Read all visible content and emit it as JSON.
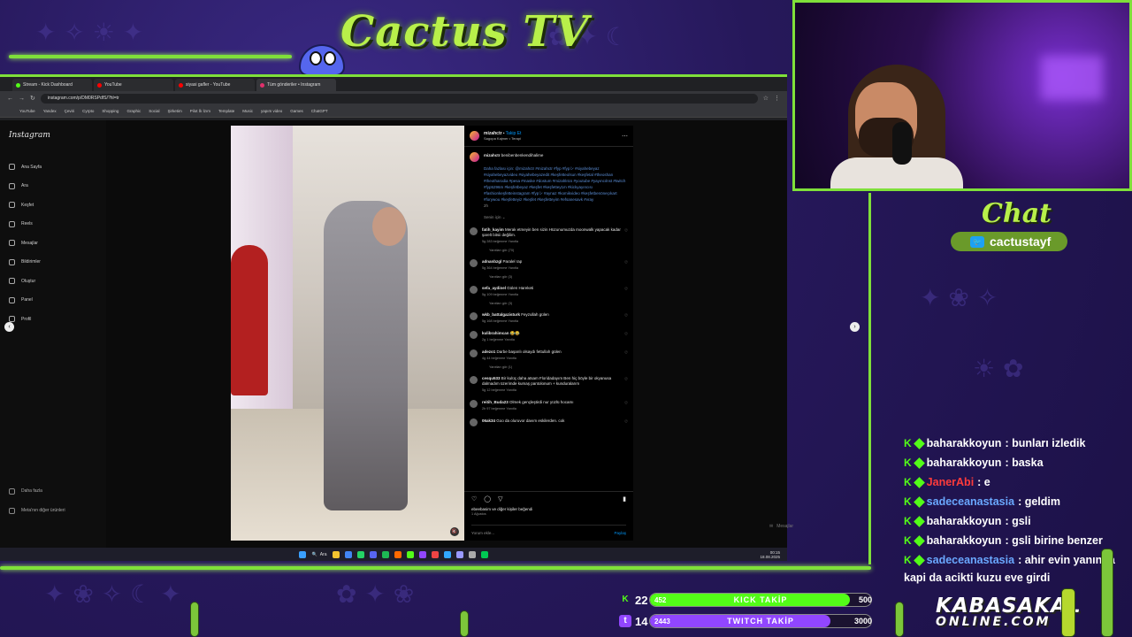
{
  "brand": {
    "title": "Cactus TV"
  },
  "browser": {
    "tabs": [
      {
        "label": "Stream - Kick Dashboard",
        "color": "#53fc18"
      },
      {
        "label": "YouTube",
        "color": "#ff0000"
      },
      {
        "label": "siyasi gafler - YouTube",
        "color": "#ff0000"
      },
      {
        "label": "Tüm gönderiler • Instagram",
        "color": "#e1306c"
      }
    ],
    "url": "instagram.com/p/DM0RSPdfS/?hl=tr",
    "bookmarks": [
      "YouTube",
      "Yandex",
      "Çeviri",
      "Cyrpto",
      "Shopping",
      "Graphic",
      "Social",
      "Şirketim",
      "Pilot İlı İzım",
      "Template",
      "Music",
      "yapım video",
      "Games",
      "ChatGPT"
    ]
  },
  "instagram": {
    "logo": "Instagram",
    "nav": [
      "Ana Sayfa",
      "Ara",
      "Keşfet",
      "Reels",
      "Mesajlar",
      "Bildirimler",
      "Oluştur",
      "Panel",
      "Profil"
    ],
    "more": [
      "Daha fazla",
      "Meta'nın diğer ürünleri"
    ],
    "post": {
      "user": "mizahctr",
      "follow": "Takip Et",
      "subtitle": "Sagopa Kajmer • Terapi",
      "caption_user": "mizahctr",
      "caption_text": "benibenbenkendihalime",
      "caption_tags": "Daha fazlası için: @mizahctr #mizahctr #fyp #fypシ #siyahebeyaz #siyahebeyazvideo #siyahebeyazedit #keşfetteolsun #keşfetal #theoshan #theotharodia #pesa #maske #dostum #mizahlıtcs #youtube #yayıncılnst #twitch #fyp5296m #keşfetbeyaz #keşfet #keşfettey1m #kickyayıncısı #fashionkeşfetteinstagram #fypシ #aynaz #komikvideo #keşfetbenöneçıkart #forywou #keşfetteyiz #keşfet #keşfetteyim #efsanesavk #vray",
      "caption_time": "2h",
      "for_you": "Senin için",
      "comments": [
        {
          "user": "fatih_kayim",
          "text": "Merak etmeyin ben sizin Hüzunumuzda moonwalk yapacak kadar şarelt bitsii değilim.",
          "meta": "5g 283 beğenme Yanıtla",
          "replies": "Yanıtları gör (70)"
        },
        {
          "user": "adnanbzgl",
          "text": "Paralel rap",
          "meta": "5g 364 beğenme Yanıtla",
          "replies": "Yanıtları gör (3)"
        },
        {
          "user": "sefa_aydinel",
          "text": "Gülen Hareketi",
          "meta": "5g 109 beğenme Yanıtla",
          "replies": "Yanıtları gör (3)"
        },
        {
          "user": "wkb_battalgazisturk",
          "text": "Feyzullah gülen",
          "meta": "5g 168 beğenme Yanıtla",
          "replies": ""
        },
        {
          "user": "kulibrahimcan",
          "text": "😂😂",
          "meta": "2g 1 beğenme Yanıtla",
          "replies": ""
        },
        {
          "user": "adezo1",
          "text": "Darbe başarılı olsaydı fettullah gülen",
          "meta": "4g 44 beğenme Yanıtla",
          "replies": "Yanıtları gör (1)"
        },
        {
          "user": "cesqu533",
          "text": "Bir kulüç daha atsam Floridadayım Ben hiç böyle bir okyanusa dalmadım üzerimde kumaş pantolonum + kunduralarım",
          "meta": "5g 12 beğenme Yanıtla",
          "replies": ""
        },
        {
          "user": "reitih_Buda23",
          "text": "Olmek gençleştirdi nur yüzlü hocamı",
          "meta": "2h 97 beğenme Yanıtla",
          "replies": ""
        },
        {
          "user": "06ak34",
          "text": "Goo da oluruvor davım eskilerden. cok",
          "meta": "",
          "replies": ""
        }
      ],
      "liked_by": "ebeebasim ve diğer kişiler beğendi",
      "date": "1 Ağustos",
      "add_comment": "Yorum ekle...",
      "share": "Paylaş"
    },
    "messages": "Mesajlar"
  },
  "taskbar": {
    "search": "Ara",
    "time": "00:15",
    "date": "18.08.2025"
  },
  "chat": {
    "title": "Chat",
    "handle": "cactustayf",
    "messages": [
      {
        "user": "baharakkoyun",
        "text": ": bunları izledik",
        "color": "#ffffff"
      },
      {
        "user": "baharakkoyun",
        "text": ": baska",
        "color": "#ffffff"
      },
      {
        "user": "JanerAbi",
        "text": ": e",
        "color": "#ff3b3b"
      },
      {
        "user": "sadeceanastasia",
        "text": ": geldim",
        "color": "#6aa8ff"
      },
      {
        "user": "baharakkoyun",
        "text": ": gsli",
        "color": "#ffffff"
      },
      {
        "user": "baharakkoyun",
        "text": ": gsli birine benzer",
        "color": "#ffffff"
      },
      {
        "user": "sadeceanastasia",
        "text": ": ahir evin yanında",
        "color": "#6aa8ff"
      }
    ],
    "last_line": "kapi da acikti kuzu eve girdi"
  },
  "goals": {
    "kick": {
      "label": "KICK TAKİP",
      "count": "22",
      "current": "452",
      "goal": "500",
      "progress": 0.904,
      "color": "#53fc18"
    },
    "twitch": {
      "label": "TWITCH TAKİP",
      "count": "14",
      "current": "2443",
      "goal": "3000",
      "progress": 0.814,
      "color": "#9146ff"
    }
  },
  "footer_logo": {
    "line1": "KABASAKAL",
    "line2": "ONLINE.COM"
  }
}
